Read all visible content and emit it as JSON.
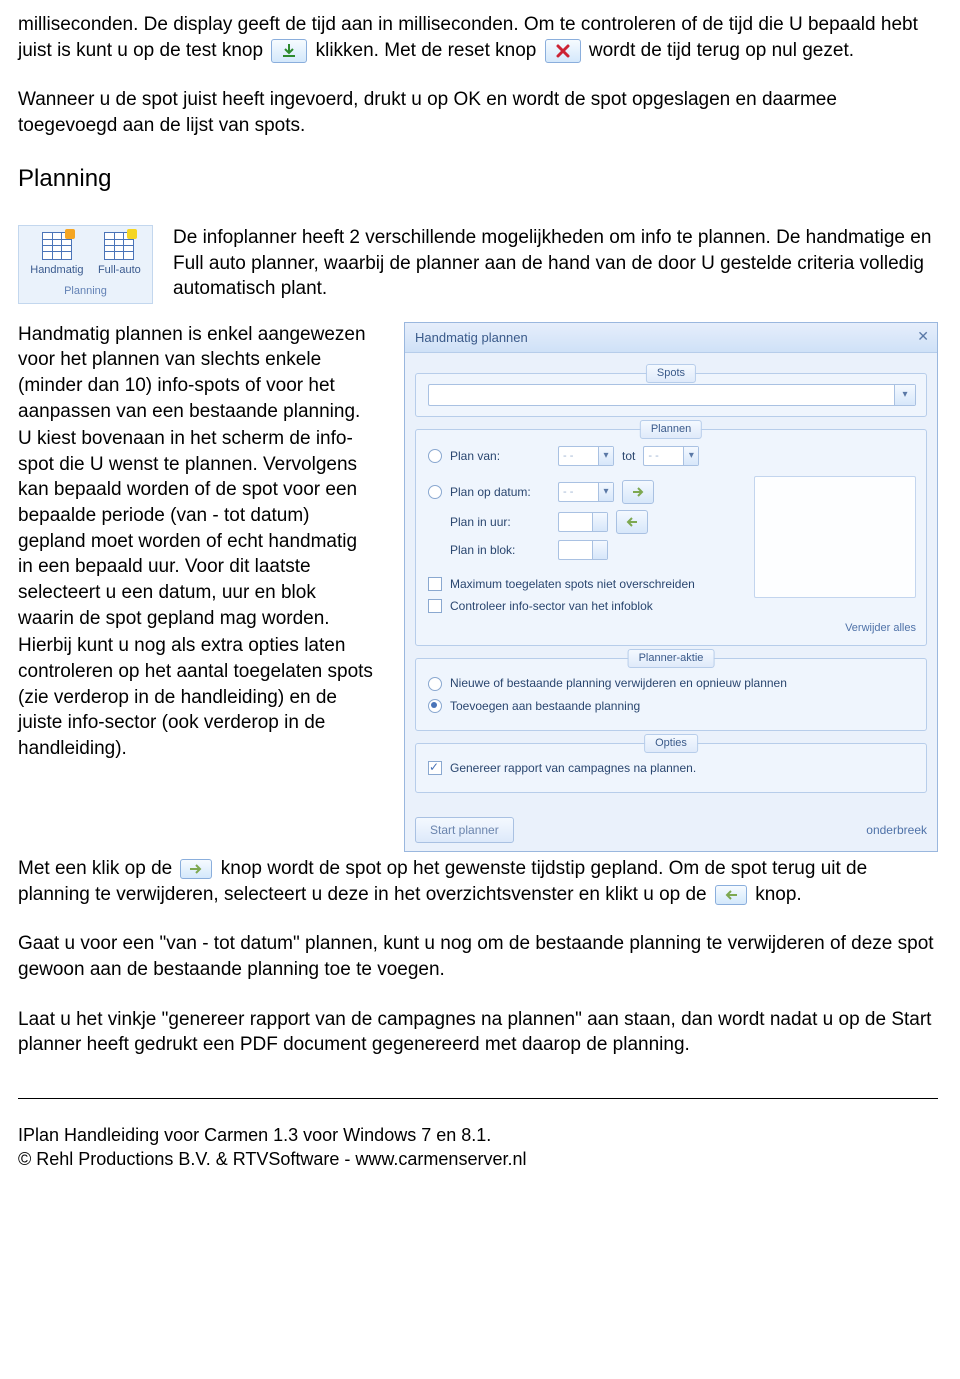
{
  "p1a": "milliseconden. De display geeft de tijd aan in milliseconden. Om te controleren of de tijd die U bepaald hebt juist is kunt u op de test knop",
  "p1b": "klikken. Met de reset knop",
  "p1c": "wordt de tijd terug op nul gezet.",
  "p2": "Wanneer u de spot juist heeft ingevoerd, drukt u op OK en wordt de spot opgeslagen en daarmee toegevoegd aan de lijst van spots.",
  "heading_planning": "Planning",
  "ribbon": {
    "handmatig": "Handmatig",
    "fullauto": "Full-auto",
    "group": "Planning"
  },
  "planning_intro": "De infoplanner heeft 2 verschillende mogelijkheden om info te plannen. De handmatige en Full auto planner, waarbij de planner aan de hand van de door U gestelde criteria volledig automatisch plant.",
  "left1": "Handmatig plannen is enkel aangewezen voor het plannen van slechts enkele (minder dan 10) info-spots of voor het aanpassen van een bestaande planning.",
  "left2": "U kiest bovenaan in het scherm de info-spot die U wenst te plannen. Vervolgens kan bepaald worden of de spot voor een bepaalde periode (van - tot datum) gepland moet worden of echt handmatig in een bepaald uur. Voor dit laatste selecteert u een datum, uur en blok waarin de spot gepland mag worden.",
  "left3": "Hierbij kunt u nog als extra opties laten controleren op het aantal toegelaten spots (zie verderop in de handleiding) en de juiste info-sector (ook verderop in de handleiding).",
  "after1a": "Met een klik op de",
  "after1b": "knop wordt de spot op het gewenste tijdstip gepland. Om de spot terug uit de planning te verwijderen, selecteert u deze in het overzichtsvenster en klikt u op de",
  "after1c": "knop.",
  "after2": "Gaat u voor een \"van - tot datum\" plannen, kunt u nog om de bestaande planning te verwijderen of deze spot gewoon aan de bestaande planning toe te voegen.",
  "after3": "Laat u het vinkje \"genereer rapport van de campagnes na plannen\" aan staan, dan wordt nadat u op de Start planner heeft gedrukt een PDF document gegenereerd met daarop de planning.",
  "dialog": {
    "title": "Handmatig plannen",
    "spots_legend": "Spots",
    "plannen_legend": "Plannen",
    "plan_van": "Plan van:",
    "tot": "tot",
    "plan_op_datum": "Plan op datum:",
    "plan_in_uur": "Plan in uur:",
    "plan_in_blok": "Plan in blok:",
    "date_placeholder": "- -",
    "chk_max": "Maximum toegelaten spots niet overschreiden",
    "chk_sector": "Controleer info-sector van het infoblok",
    "verwijder_alles": "Verwijder alles",
    "planner_aktie_legend": "Planner-aktie",
    "rad_nieuwe": "Nieuwe of bestaande planning verwijderen en opnieuw plannen",
    "rad_toevoegen": "Toevoegen aan bestaande planning",
    "opties_legend": "Opties",
    "chk_rapport": "Genereer rapport van campagnes na plannen.",
    "btn_start": "Start planner",
    "btn_onderbreek": "onderbreek"
  },
  "footer1": "IPlan Handleiding voor Carmen 1.3 voor Windows 7 en 8.1.",
  "footer2": "© Rehl Productions B.V. & RTVSoftware - www.carmenserver.nl"
}
